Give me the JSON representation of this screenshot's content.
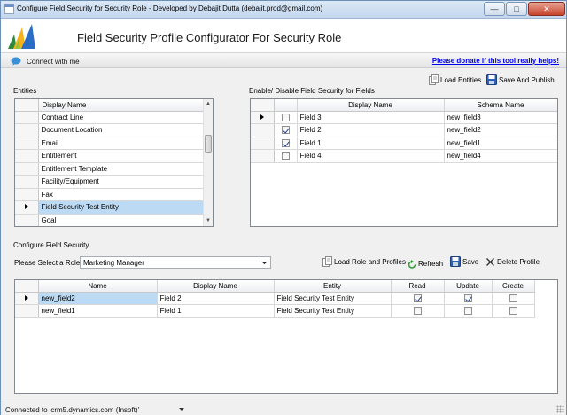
{
  "window": {
    "title": "Configure Field Security for Security Role - Developed by Debajit Dutta (debajit.prod@gmail.com)",
    "controls": [
      "minimize-icon",
      "maximize-icon",
      "close-icon"
    ]
  },
  "header": {
    "title": "Field Security Profile Configurator For Security Role",
    "logo_icon": "dynamics-crm-logo-icon"
  },
  "connect": {
    "label": "Connect with me",
    "icon": "chat-bubble-icon",
    "donate_link": "Please donate if this tool really helps!"
  },
  "entities": {
    "label": "Entities",
    "column": "Display Name",
    "rows": [
      "Contract Line",
      "Document Location",
      "Email",
      "Entitlement",
      "Entitlement Template",
      "Facility/Equipment",
      "Fax",
      "Field Security Test Entity",
      "Goal"
    ],
    "selected_index": 7
  },
  "fields": {
    "label": "Enable/ Disable Field Security for Fields",
    "load_button": "Load Entities",
    "save_publish_button": "Save And Publish",
    "columns": [
      "Display Name",
      "Schema Name"
    ],
    "rows": [
      {
        "checked": false,
        "display": "Field 3",
        "schema": "new_field3",
        "current": true
      },
      {
        "checked": true,
        "display": "Field 2",
        "schema": "new_field2",
        "current": false
      },
      {
        "checked": true,
        "display": "Field 1",
        "schema": "new_field1",
        "current": false
      },
      {
        "checked": false,
        "display": "Field 4",
        "schema": "new_field4",
        "current": false
      }
    ]
  },
  "configure": {
    "label": "Configure Field Security",
    "role_label": "Please Select a Role",
    "role_value": "Marketing Manager",
    "load_role_button": "Load Role and Profiles",
    "refresh_button": "Refresh",
    "save_button": "Save",
    "delete_button": "Delete Profile",
    "columns": [
      "Name",
      "Display Name",
      "Entity",
      "Read",
      "Update",
      "Create"
    ],
    "rows": [
      {
        "name": "new_field2",
        "display": "Field 2",
        "entity": "Field Security Test Entity",
        "read": true,
        "update": true,
        "create": false,
        "current": true
      },
      {
        "name": "new_field1",
        "display": "Field 1",
        "entity": "Field Security Test Entity",
        "read": false,
        "update": false,
        "create": false,
        "current": false
      }
    ]
  },
  "status": {
    "text": "Connected to 'crm5.dynamics.com (Insoft)'"
  }
}
